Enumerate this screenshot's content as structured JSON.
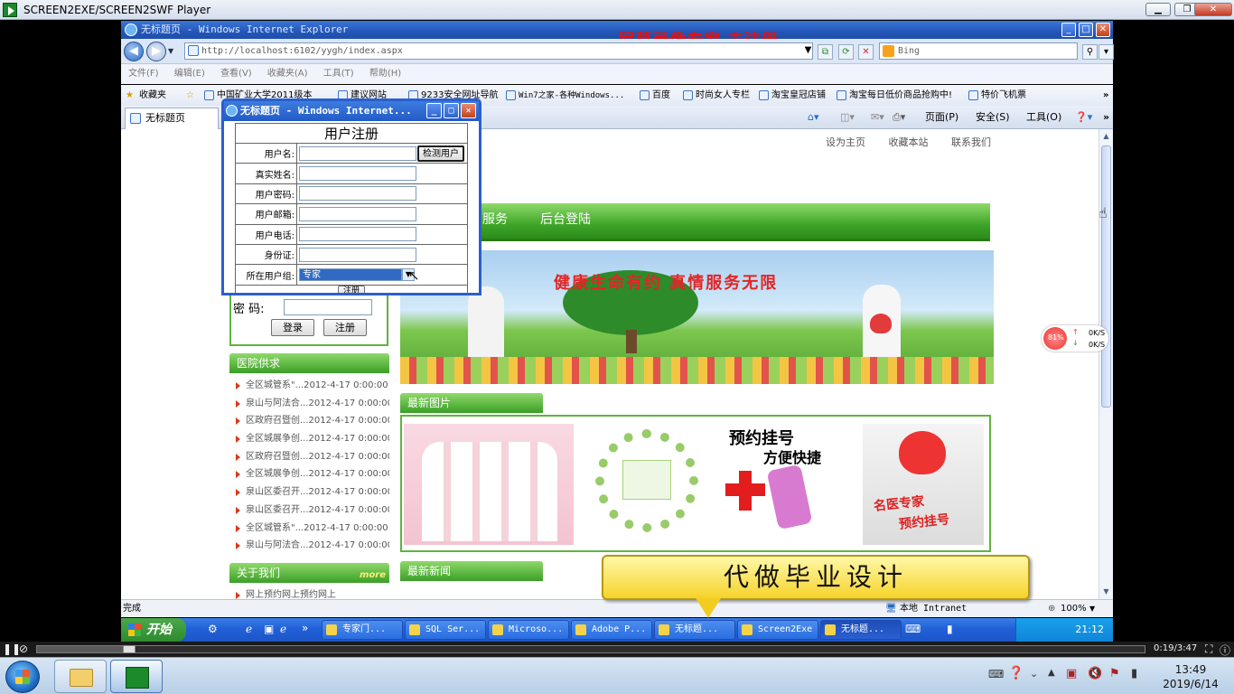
{
  "player": {
    "title": "SCREEN2EXE/SCREEN2SWF Player",
    "time": "0:19/3:47",
    "progress": 0.084
  },
  "ie": {
    "title": "无标题页 - Windows Internet Explorer",
    "url": "http://localhost:6102/yygh/index.aspx",
    "search_placeholder": "Bing"
  },
  "watermark": "屏幕录像专家  未注册",
  "menu": [
    "文件(F)",
    "编辑(E)",
    "查看(V)",
    "收藏夹(A)",
    "工具(T)",
    "帮助(H)"
  ],
  "favorites": {
    "label": "收藏夹",
    "items": [
      "中国矿业大学2011级本",
      "建议网站",
      "9233安全网址导航",
      "Win7之家-各种Windows...",
      "百度",
      "时尚女人专栏",
      "淘宝皇冠店铺",
      "淘宝每日低价商品抢购中!",
      "特价飞机票"
    ]
  },
  "tab": {
    "label": "无标题页"
  },
  "commands": {
    "page": "页面(P)",
    "safety": "安全(S)",
    "tools": "工具(O)"
  },
  "site": {
    "toplinks": [
      "设为主页",
      "收藏本站",
      "联系我们"
    ],
    "nav": [
      "服务",
      "后台登陆"
    ],
    "banner_slogan": "健康生命有约   真情服务无限",
    "login": {
      "pwd_label": "密   码:",
      "login_btn": "登录",
      "reg_btn": "注册"
    },
    "notice_title": "医院供求",
    "notices": [
      "全区城管系\"...2012-4-17 0:00:00",
      "泉山与阿法合...2012-4-17 0:00:00",
      "区政府召暨创...2012-4-17 0:00:00",
      "全区城展争创...2012-4-17 0:00:00",
      "区政府召暨创...2012-4-17 0:00:00",
      "全区城展争创...2012-4-17 0:00:00",
      "泉山区委召开...2012-4-17 0:00:00",
      "泉山区委召开...2012-4-17 0:00:00",
      "全区城管系\"...2012-4-17 0:00:00",
      "泉山与阿法合...2012-4-17 0:00:00"
    ],
    "about_title": "关于我们",
    "about_more": "more",
    "about_item": "网上预约网上预约网上",
    "pics_title": "最新图片",
    "pics": {
      "p3_title": "预约挂号",
      "p3_sub": "方便快捷",
      "p4_line1": "名医专家",
      "p4_line2": "预约挂号"
    },
    "news_title": "最新新闻"
  },
  "dialog": {
    "title": "无标题页 - Windows Internet...",
    "heading": "用户注册",
    "check_btn": "检测用户",
    "fields": [
      "用户名:",
      "真实姓名:",
      "用户密码:",
      "用户邮箱:",
      "用户电话:",
      "身份证:",
      "所在用户组:"
    ],
    "group_value": "专家",
    "submit": "注册"
  },
  "statusbar": {
    "text": "完成",
    "zone": "本地 Intranet",
    "zoom": "100%"
  },
  "xp_taskbar": {
    "start": "开始",
    "buttons": [
      "专家门...",
      "SQL Ser...",
      "Microso...",
      "Adobe P...",
      "无标题...",
      "Screen2Exe",
      "无标题..."
    ],
    "time": "21:12"
  },
  "netwidget": {
    "pct": "81%",
    "up": "0K/S",
    "down": "0K/S"
  },
  "popup": "代做毕业设计",
  "win7": {
    "time": "13:49",
    "date": "2019/6/14"
  }
}
